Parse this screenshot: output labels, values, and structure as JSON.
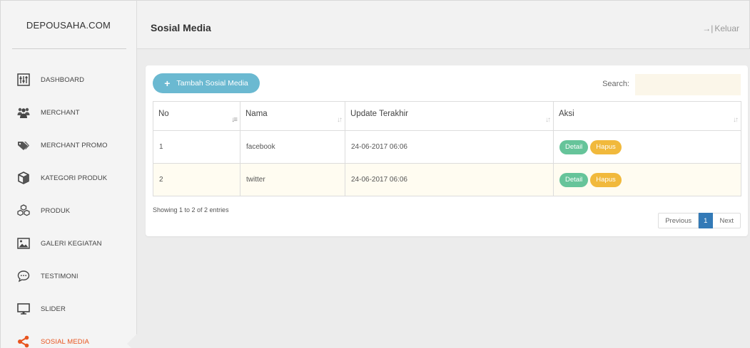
{
  "brand": "DEPOUSAHA.COM",
  "header": {
    "title": "Sosial Media",
    "logout_label": "Keluar",
    "logout_arrow": "→|"
  },
  "nav": [
    {
      "label": "DASHBOARD",
      "icon": "dashboard-icon"
    },
    {
      "label": "MERCHANT",
      "icon": "users-icon"
    },
    {
      "label": "MERCHANT PROMO",
      "icon": "tags-icon"
    },
    {
      "label": "KATEGORI PRODUK",
      "icon": "cube-icon"
    },
    {
      "label": "PRODUK",
      "icon": "cubes-icon"
    },
    {
      "label": "GALERI KEGIATAN",
      "icon": "image-icon"
    },
    {
      "label": "TESTIMONI",
      "icon": "comment-icon"
    },
    {
      "label": "SLIDER",
      "icon": "monitor-icon"
    },
    {
      "label": "SOSIAL MEDIA",
      "icon": "share-icon",
      "active": true
    }
  ],
  "toolbar": {
    "add_label": "Tambah Sosial Media",
    "search_label": "Search:",
    "search_value": ""
  },
  "table": {
    "columns": [
      "No",
      "Nama",
      "Update Terakhir",
      "Aksi"
    ],
    "rows": [
      {
        "no": "1",
        "nama": "facebook",
        "update": "24-06-2017 06:06"
      },
      {
        "no": "2",
        "nama": "twitter",
        "update": "24-06-2017 06:06"
      }
    ],
    "detail_label": "Detail",
    "hapus_label": "Hapus"
  },
  "footer": {
    "info": "Showing 1 to 2 of 2 entries",
    "prev": "Previous",
    "page": "1",
    "next": "Next"
  },
  "colors": {
    "accent": "#e8541e",
    "add_button": "#6bb9d1",
    "detail": "#66c49a",
    "hapus": "#f1b93c",
    "page_active": "#337ab7"
  }
}
